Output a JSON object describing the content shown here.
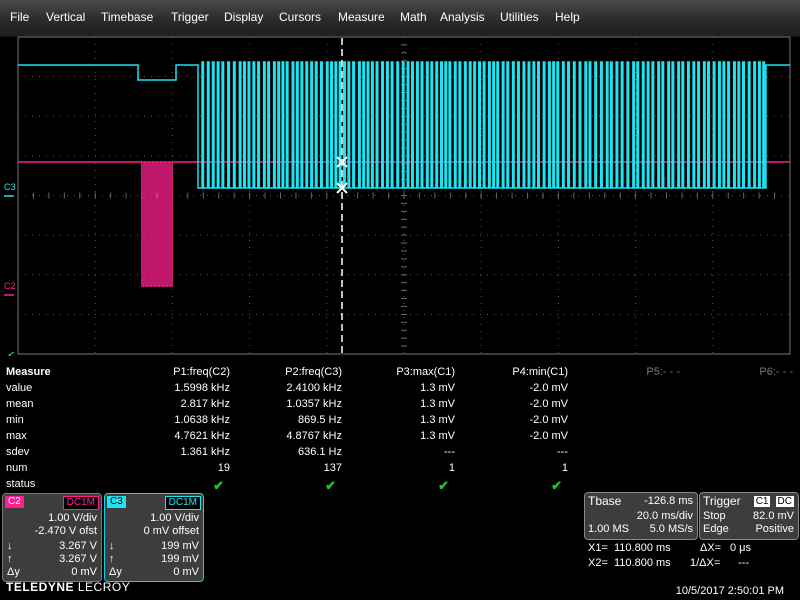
{
  "menu": [
    "File",
    "Vertical",
    "Timebase",
    "Trigger",
    "Display",
    "Cursors",
    "Measure",
    "Math",
    "Analysis",
    "Utilities",
    "Help"
  ],
  "colors": {
    "c2": "#ff1f8e",
    "c3": "#1ee3f0",
    "grid": "#6a6a6a",
    "ok": "#1ec81e"
  },
  "markers": {
    "c3": "C3",
    "c2": "C2"
  },
  "measure": {
    "title": "Measure",
    "columns": [
      "P1:freq(C2)",
      "P2:freq(C3)",
      "P3:max(C1)",
      "P4:min(C1)",
      "P5:- - -",
      "P6:- - -"
    ],
    "row_labels": [
      "value",
      "mean",
      "min",
      "max",
      "sdev",
      "num",
      "status"
    ],
    "rows": [
      [
        "1.5998 kHz",
        "2.4100 kHz",
        "1.3 mV",
        "-2.0 mV"
      ],
      [
        "2.817 kHz",
        "1.0357 kHz",
        "1.3 mV",
        "-2.0 mV"
      ],
      [
        "1.0638 kHz",
        "869.5 Hz",
        "1.3 mV",
        "-2.0 mV"
      ],
      [
        "4.7621 kHz",
        "4.8767 kHz",
        "1.3 mV",
        "-2.0 mV"
      ],
      [
        "1.361 kHz",
        "636.1 Hz",
        "---",
        "---"
      ],
      [
        "19",
        "137",
        "1",
        "1"
      ]
    ],
    "status_icon": "check-icon",
    "status_glyph": "✔"
  },
  "channels": {
    "c2": {
      "name": "C2",
      "coupling": "DC1M",
      "scale": "1.00 V/div",
      "offset": "-2.470 V ofst",
      "rows": [
        [
          "↓",
          "3.267 V"
        ],
        [
          "↑",
          "3.267 V"
        ],
        [
          "Δy",
          "0 mV"
        ]
      ]
    },
    "c3": {
      "name": "C3",
      "coupling": "DC1M",
      "scale": "1.00 V/div",
      "offset": "0 mV offset",
      "rows": [
        [
          "↓",
          "199 mV"
        ],
        [
          "↑",
          "199 mV"
        ],
        [
          "Δy",
          "0 mV"
        ]
      ]
    }
  },
  "timebase": {
    "label": "Tbase",
    "delay": "-126.8 ms",
    "rate": "20.0 ms/div",
    "samples": "1.00 MS",
    "sample_rate": "5.0 MS/s"
  },
  "trigger": {
    "label": "Trigger",
    "source": "C1",
    "coupling": "DC",
    "mode": "Stop",
    "level": "82.0 mV",
    "edge": "Edge",
    "slope": "Positive"
  },
  "cursors": {
    "x1_label": "X1=",
    "x1": "110.800 ms",
    "dx_label": "ΔX=",
    "dx": "0 μs",
    "x2_label": "X2=",
    "x2": "110.800 ms",
    "inv_dx_label": "1/ΔX=",
    "inv_dx": "---"
  },
  "brand": {
    "main": "TELEDYNE",
    "sub": "LECROY"
  },
  "datetime": "10/5/2017 2:50:01 PM"
}
